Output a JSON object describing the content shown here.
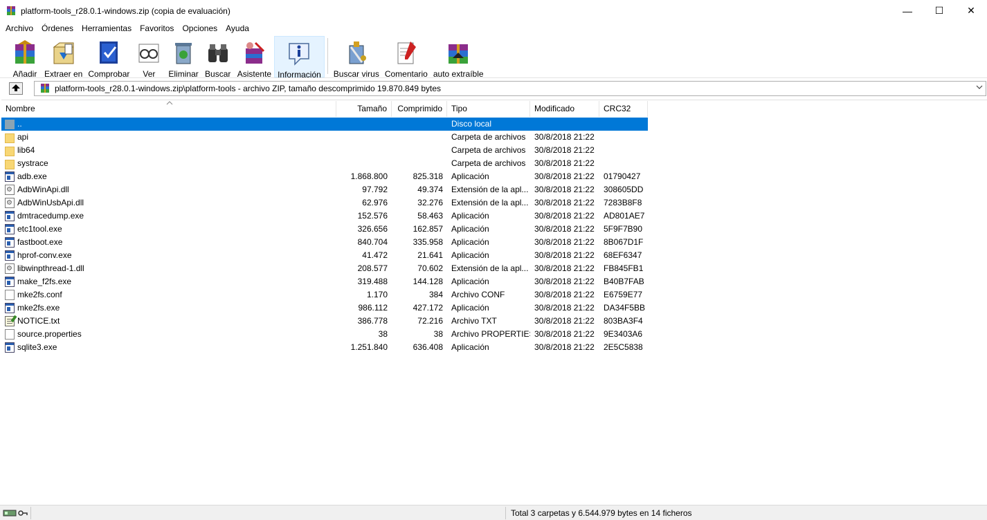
{
  "window": {
    "title": "platform-tools_r28.0.1-windows.zip (copia de evaluación)",
    "controls": {
      "minimize": "—",
      "maximize": "☐",
      "close": "✕"
    }
  },
  "menu": [
    "Archivo",
    "Órdenes",
    "Herramientas",
    "Favoritos",
    "Opciones",
    "Ayuda"
  ],
  "toolbar": [
    {
      "label": "Añadir",
      "icon": "add-icon"
    },
    {
      "label": "Extraer en",
      "icon": "extract-icon"
    },
    {
      "label": "Comprobar",
      "icon": "test-icon"
    },
    {
      "label": "Ver",
      "icon": "view-icon"
    },
    {
      "label": "Eliminar",
      "icon": "delete-icon"
    },
    {
      "label": "Buscar",
      "icon": "find-icon"
    },
    {
      "label": "Asistente",
      "icon": "wizard-icon"
    },
    {
      "label": "Información",
      "icon": "info-icon",
      "active": true
    },
    {
      "label": "Buscar virus",
      "icon": "virus-scan-icon"
    },
    {
      "label": "Comentario",
      "icon": "comment-icon"
    },
    {
      "label": "auto extraíble",
      "icon": "sfx-icon"
    }
  ],
  "address": {
    "path": "platform-tools_r28.0.1-windows.zip\\platform-tools - archivo ZIP, tamaño descomprimido 19.870.849 bytes"
  },
  "columns": {
    "name": "Nombre",
    "size": "Tamaño",
    "compressed": "Comprimido",
    "type": "Tipo",
    "modified": "Modificado",
    "crc": "CRC32"
  },
  "rows": [
    {
      "name": "..",
      "size": "",
      "comp": "",
      "type": "Disco local",
      "mod": "",
      "crc": "",
      "icon": "updir",
      "selected": true
    },
    {
      "name": "api",
      "size": "",
      "comp": "",
      "type": "Carpeta de archivos",
      "mod": "30/8/2018 21:22",
      "crc": "",
      "icon": "folder"
    },
    {
      "name": "lib64",
      "size": "",
      "comp": "",
      "type": "Carpeta de archivos",
      "mod": "30/8/2018 21:22",
      "crc": "",
      "icon": "folder"
    },
    {
      "name": "systrace",
      "size": "",
      "comp": "",
      "type": "Carpeta de archivos",
      "mod": "30/8/2018 21:22",
      "crc": "",
      "icon": "folder"
    },
    {
      "name": "adb.exe",
      "size": "1.868.800",
      "comp": "825.318",
      "type": "Aplicación",
      "mod": "30/8/2018 21:22",
      "crc": "01790427",
      "icon": "exe"
    },
    {
      "name": "AdbWinApi.dll",
      "size": "97.792",
      "comp": "49.374",
      "type": "Extensión de la apl...",
      "mod": "30/8/2018 21:22",
      "crc": "308605DD",
      "icon": "dll"
    },
    {
      "name": "AdbWinUsbApi.dll",
      "size": "62.976",
      "comp": "32.276",
      "type": "Extensión de la apl...",
      "mod": "30/8/2018 21:22",
      "crc": "7283B8F8",
      "icon": "dll"
    },
    {
      "name": "dmtracedump.exe",
      "size": "152.576",
      "comp": "58.463",
      "type": "Aplicación",
      "mod": "30/8/2018 21:22",
      "crc": "AD801AE7",
      "icon": "exe"
    },
    {
      "name": "etc1tool.exe",
      "size": "326.656",
      "comp": "162.857",
      "type": "Aplicación",
      "mod": "30/8/2018 21:22",
      "crc": "5F9F7B90",
      "icon": "exe"
    },
    {
      "name": "fastboot.exe",
      "size": "840.704",
      "comp": "335.958",
      "type": "Aplicación",
      "mod": "30/8/2018 21:22",
      "crc": "8B067D1F",
      "icon": "exe"
    },
    {
      "name": "hprof-conv.exe",
      "size": "41.472",
      "comp": "21.641",
      "type": "Aplicación",
      "mod": "30/8/2018 21:22",
      "crc": "68EF6347",
      "icon": "exe"
    },
    {
      "name": "libwinpthread-1.dll",
      "size": "208.577",
      "comp": "70.602",
      "type": "Extensión de la apl...",
      "mod": "30/8/2018 21:22",
      "crc": "FB845FB1",
      "icon": "dll"
    },
    {
      "name": "make_f2fs.exe",
      "size": "319.488",
      "comp": "144.128",
      "type": "Aplicación",
      "mod": "30/8/2018 21:22",
      "crc": "B40B7FAB",
      "icon": "exe"
    },
    {
      "name": "mke2fs.conf",
      "size": "1.170",
      "comp": "384",
      "type": "Archivo CONF",
      "mod": "30/8/2018 21:22",
      "crc": "E6759E77",
      "icon": "doc"
    },
    {
      "name": "mke2fs.exe",
      "size": "986.112",
      "comp": "427.172",
      "type": "Aplicación",
      "mod": "30/8/2018 21:22",
      "crc": "DA34F5BB",
      "icon": "exe"
    },
    {
      "name": "NOTICE.txt",
      "size": "386.778",
      "comp": "72.216",
      "type": "Archivo TXT",
      "mod": "30/8/2018 21:22",
      "crc": "803BA3F4",
      "icon": "txt"
    },
    {
      "name": "source.properties",
      "size": "38",
      "comp": "38",
      "type": "Archivo PROPERTIES",
      "mod": "30/8/2018 21:22",
      "crc": "9E3403A6",
      "icon": "doc"
    },
    {
      "name": "sqlite3.exe",
      "size": "1.251.840",
      "comp": "636.408",
      "type": "Aplicación",
      "mod": "30/8/2018 21:22",
      "crc": "2E5C5838",
      "icon": "exe"
    }
  ],
  "status": {
    "summary": "Total 3 carpetas y 6.544.979 bytes en 14 ficheros"
  },
  "colors": {
    "selection": "#0078d7",
    "folder": "#f8d775"
  }
}
